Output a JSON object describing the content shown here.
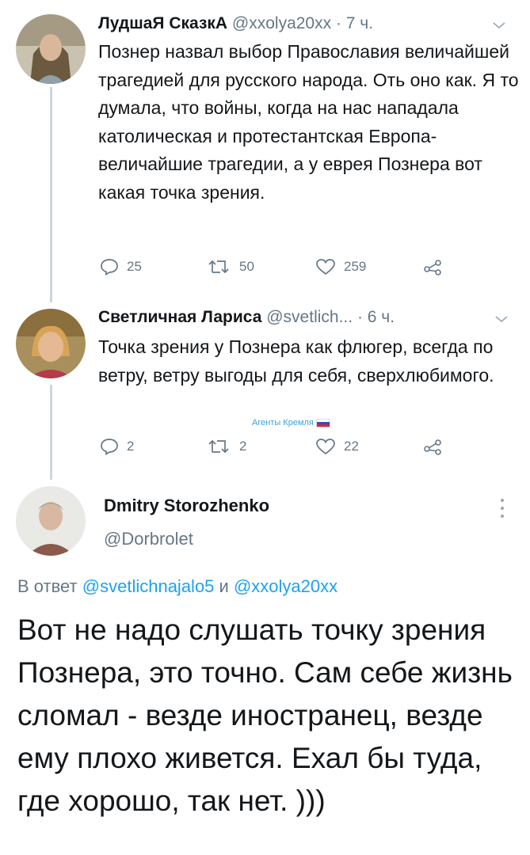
{
  "tweets": [
    {
      "name": "ЛудшаЯ СказкА",
      "handle": "@xxolya20xx",
      "time": "· 7 ч.",
      "text": "Познер назвал выбор Православия величайшей трагедией для русского народа. Оть оно как. Я то думала, что войны, когда на нас нападала католическая и протестантская Европа- величайшие трагедии, а у еврея Познера вот какая точка зрения.",
      "replies": "25",
      "retweets": "50",
      "likes": "259"
    },
    {
      "name": "Светличная Лариса",
      "handle": "@svetlich...",
      "time": "· 6 ч.",
      "text": "Точка зрения у Познера как флюгер, всегда по ветру, ветру выгоды для себя, сверхлюбимого.",
      "badge": "Агенты Кремля",
      "replies": "2",
      "retweets": "2",
      "likes": "22"
    }
  ],
  "main_tweet": {
    "name": "Dmitry Storozhenko",
    "handle": "@Dorbrolet",
    "reply_prefix": "В ответ",
    "reply_user1": "@svetlichnajalo5",
    "reply_and": "и",
    "reply_user2": "@xxolya20xx",
    "text": "Вот не надо слушать точку зрения Познера, это точно. Сам себе жизнь сломал - везде иностранец, везде ему плохо живется. Ехал бы туда, где хорошо, так нет. )))"
  },
  "colors": {
    "link": "#1da1f2",
    "secondary": "#657786",
    "thread_line": "#ccd6dd"
  },
  "icons": {
    "reply": "reply-icon",
    "retweet": "retweet-icon",
    "like": "heart-icon",
    "share": "share-icon",
    "menu": "chevron-down-icon",
    "more": "more-vertical-icon"
  }
}
